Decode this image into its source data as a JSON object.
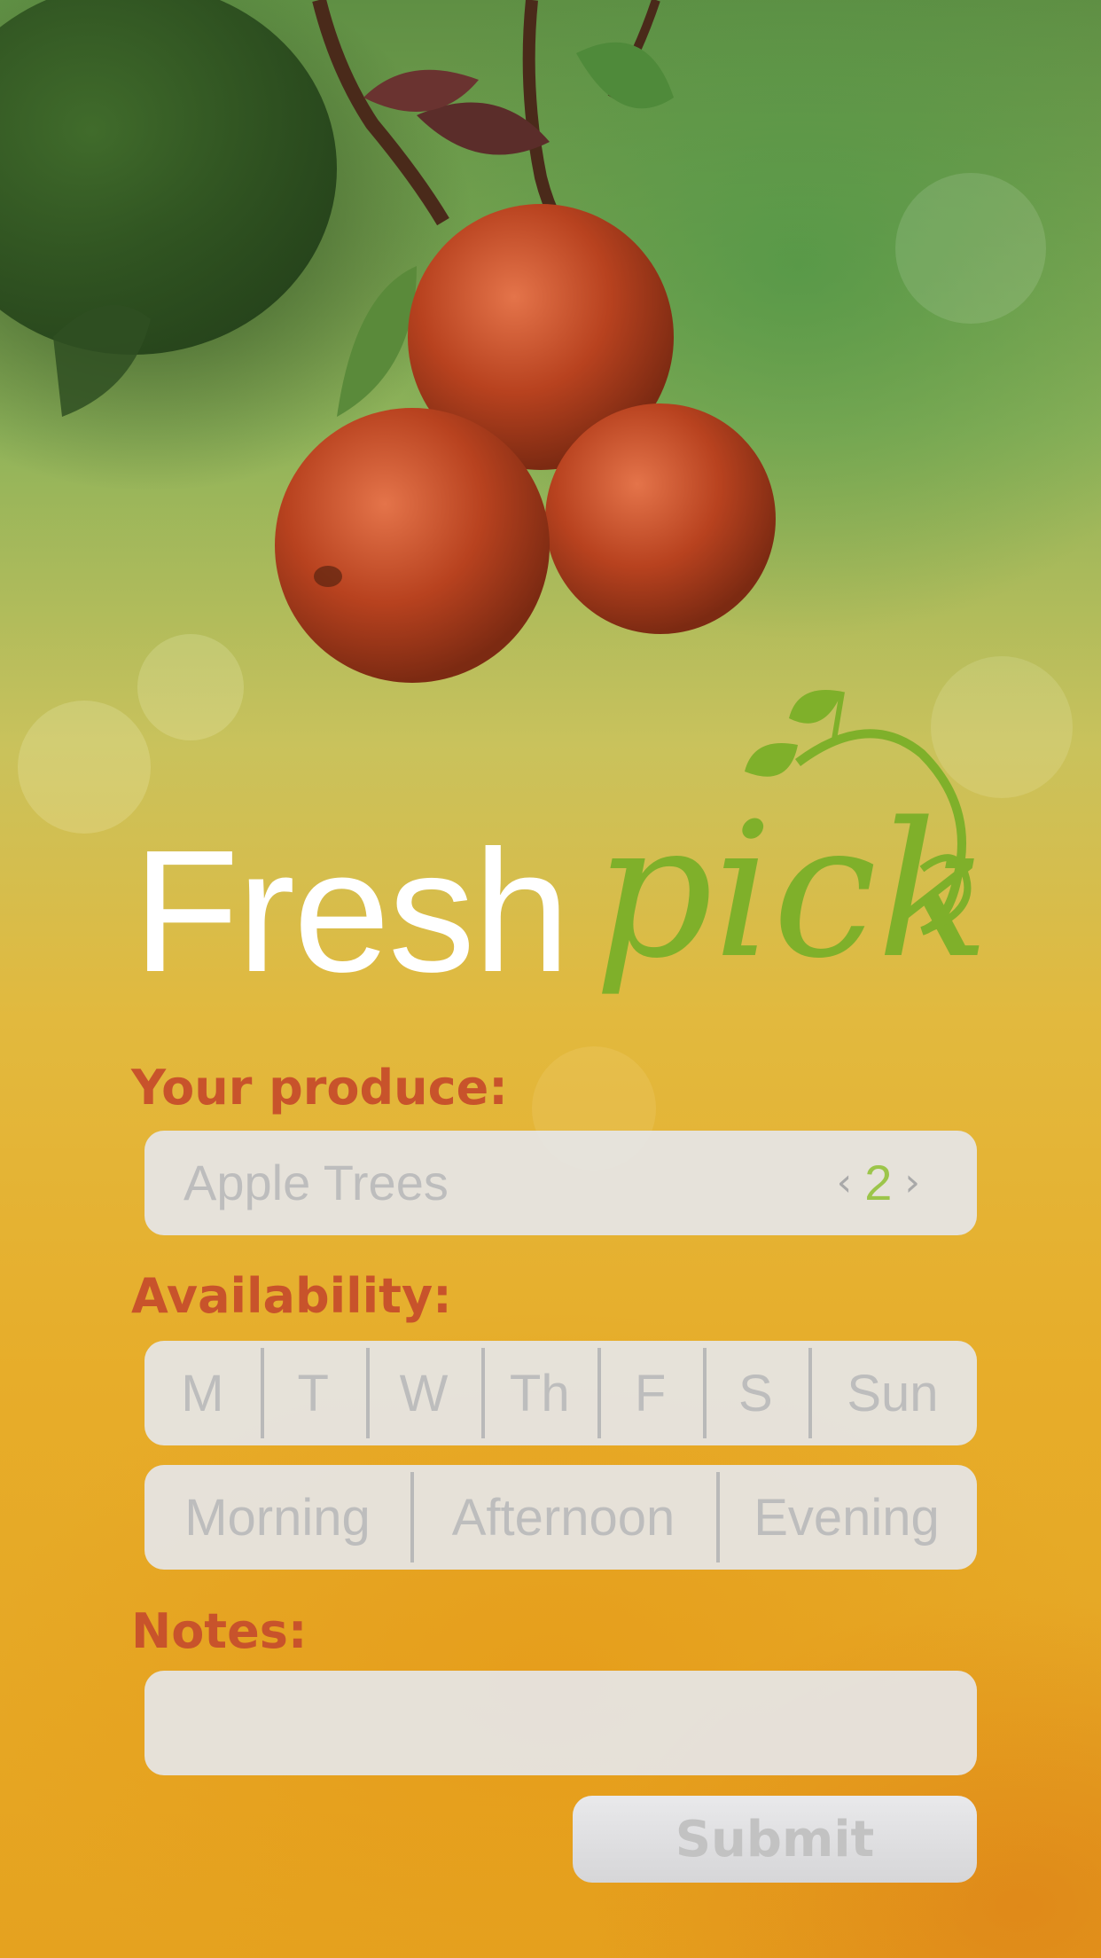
{
  "brand": {
    "word_white": "Fresh",
    "word_green": "pick",
    "white_color": "#ffffff",
    "green_color": "#7fb02a"
  },
  "produce": {
    "label": "Your produce:",
    "value": "Apple Trees",
    "count": "2",
    "prev_symbol": "‹",
    "next_symbol": "›"
  },
  "availability": {
    "label": "Availability:",
    "days": [
      "M",
      "T",
      "W",
      "Th",
      "F",
      "S",
      "Sun"
    ],
    "times": [
      "Morning",
      "Afternoon",
      "Evening"
    ]
  },
  "notes": {
    "label": "Notes:",
    "value": ""
  },
  "submit": {
    "label": "Submit"
  },
  "colors": {
    "label": "#c8532b",
    "field_bg": "#e6e6e8",
    "field_text": "#bdbdbd",
    "count_accent": "#9cc54a"
  },
  "background": {
    "subject": "apples-on-branch-icon"
  }
}
